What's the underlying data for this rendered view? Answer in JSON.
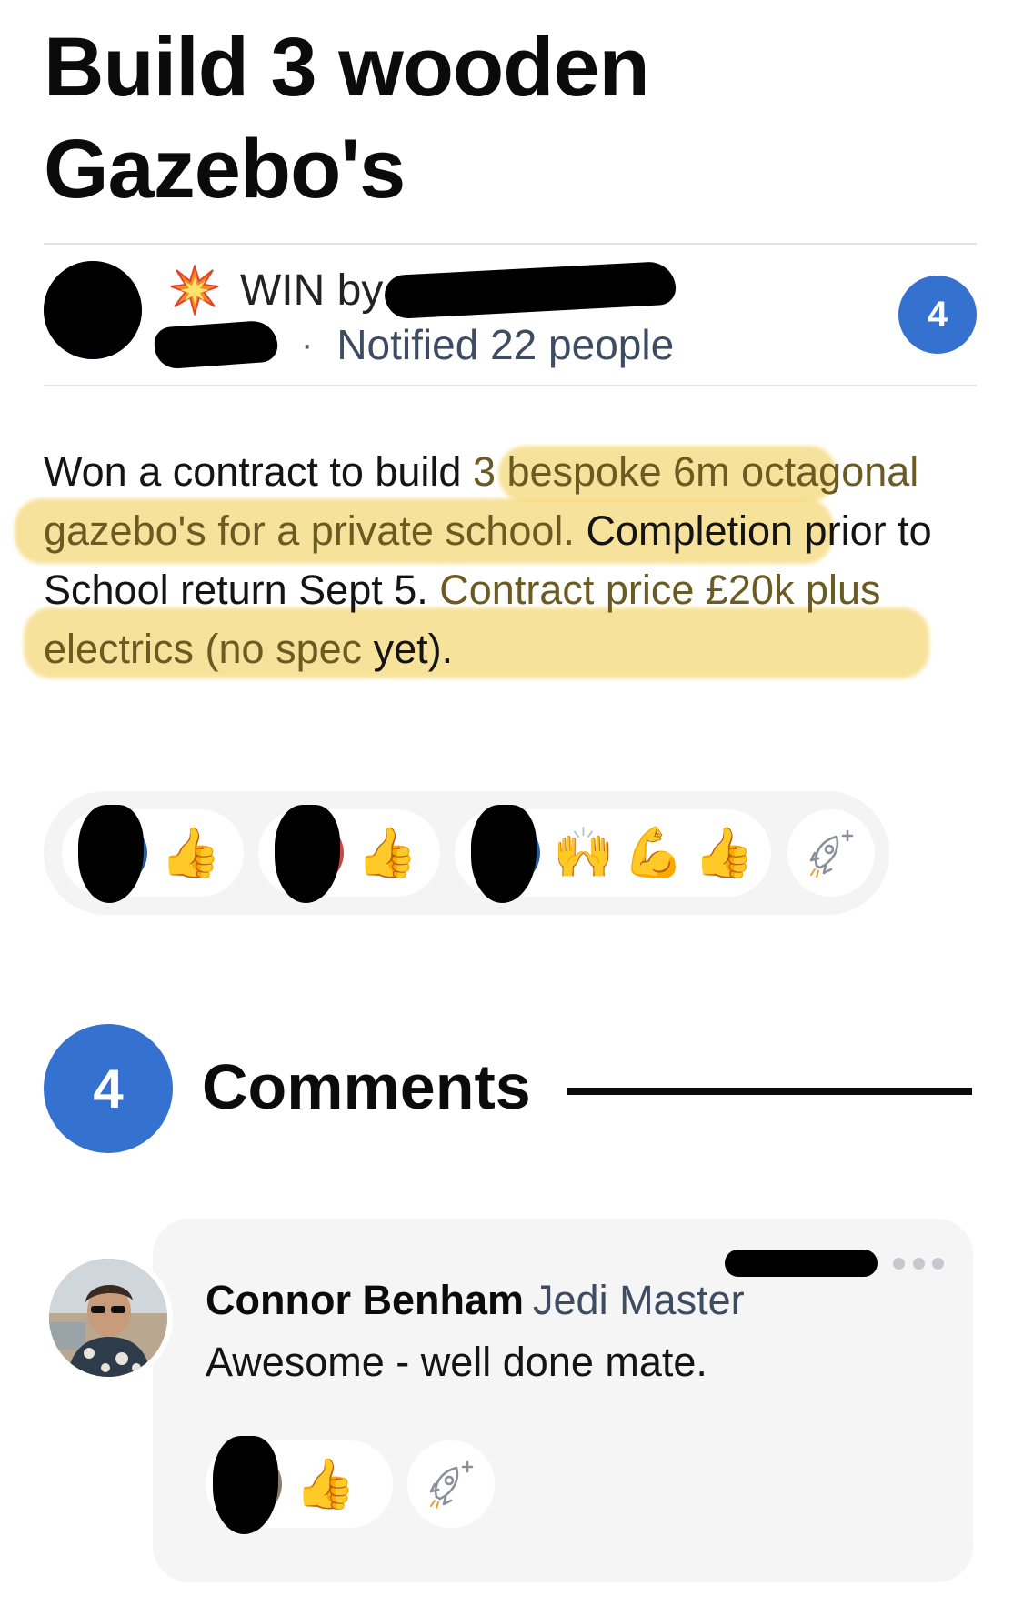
{
  "post": {
    "title": "Build 3 wooden Gazebo's",
    "type_label": "WIN by",
    "type_icon": "burst-icon",
    "notified_text": "Notified 22 people",
    "dot_separator": "·",
    "comment_count": "4",
    "body_plain_1": "Won a contract to build ",
    "body_highlight_1": "3 bespoke 6m octagonal gazebo's for a private school.",
    "body_plain_2": " Completion prior to School return Sept 5. ",
    "body_highlight_2": "Contract price £20k plus electrics (no spec",
    "body_plain_3": " yet).",
    "highlight_color": "#f5d97a",
    "accent_color": "#3571cf"
  },
  "reactions": {
    "pills": [
      {
        "emojis": [
          "👍"
        ]
      },
      {
        "emojis": [
          "👍"
        ]
      },
      {
        "emojis": [
          "🙌",
          "💪",
          "👍"
        ]
      }
    ],
    "add_reaction_icon": "rocket-add-icon"
  },
  "comments": {
    "count": "4",
    "heading": "Comments",
    "items": [
      {
        "author": "Connor Benham",
        "role": "Jedi Master",
        "text": "Awesome - well done mate.",
        "reaction_emoji": "👍",
        "add_reaction_icon": "rocket-add-icon",
        "more_icon": "more-dots-icon"
      }
    ]
  }
}
